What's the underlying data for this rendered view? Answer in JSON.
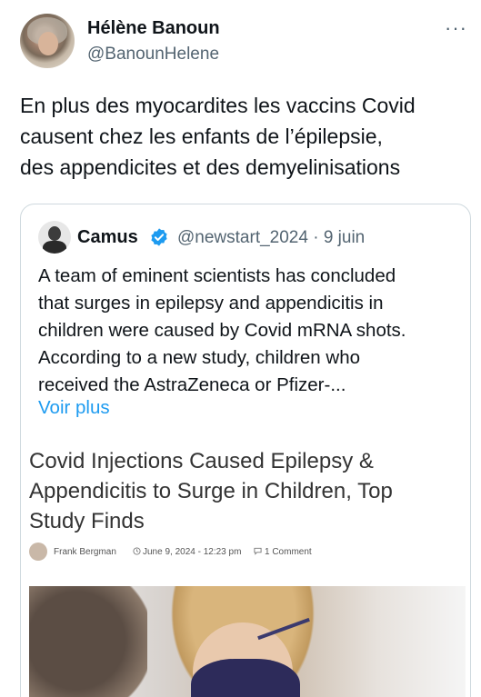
{
  "tweet": {
    "author_name": "Hélène Banoun",
    "author_handle": "@BanounHelene",
    "more_label": "···",
    "text": "En plus des myocardites les vaccins Covid\ncausent chez les enfants de l’épilepsie,\ndes appendicites et des demyelinisations"
  },
  "quoted": {
    "author_name": "Camus",
    "verified_icon": "verified-badge",
    "handle_date": "@newstart_2024 · 9 juin",
    "text": "A team of eminent scientists has concluded\nthat surges in epilepsy and appendicitis in\nchildren were caused by Covid mRNA shots.\nAccording to a new study, children who\nreceived the AstraZeneca or Pfizer-...",
    "show_more": "Voir plus",
    "article": {
      "title": "Covid Injections Caused Epilepsy &\nAppendicitis to Surge in Children, Top\nStudy Finds",
      "author": "Frank Bergman",
      "date": "June 9, 2024 - 12:23 pm",
      "comments": "1 Comment"
    }
  },
  "colors": {
    "link": "#1d9bf0",
    "secondary_text": "#536471",
    "border": "#cfd9de"
  }
}
